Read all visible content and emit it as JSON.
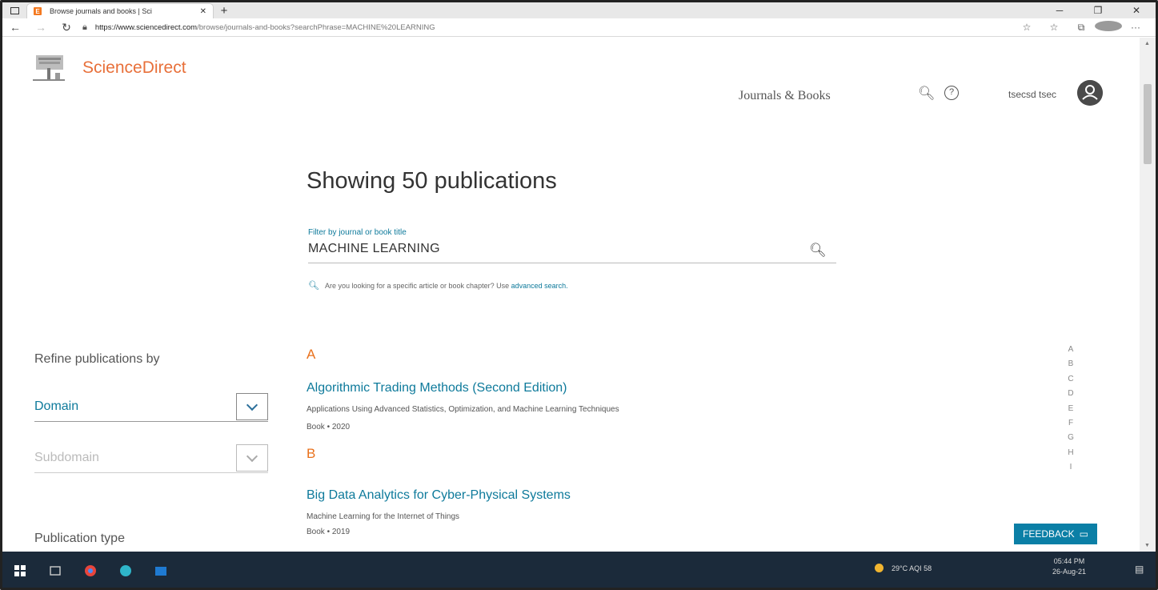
{
  "browser": {
    "tab_title": "Browse journals and books | Sci",
    "tab_favicon": "E",
    "tab_close": "✕",
    "new_tab": "+",
    "window_controls": [
      "─",
      "❐",
      "✕"
    ],
    "url_domain": "https://www.sciencedirect.com",
    "url_path": "/browse/journals-and-books?searchPhrase=MACHINE%20LEARNING"
  },
  "header": {
    "brand": "ScienceDirect",
    "journals_link": "Journals & Books",
    "user_name": "tsecsd tsec"
  },
  "main": {
    "heading": "Showing 50 publications",
    "filter_label": "Filter by journal or book title",
    "filter_value": "MACHINE LEARNING",
    "hint_text": "Are you looking for a specific article or book chapter? Use ",
    "hint_link": "advanced search."
  },
  "sidebar": {
    "refine_title": "Refine publications by",
    "domain_label": "Domain",
    "subdomain_label": "Subdomain",
    "pubtype_title": "Publication type"
  },
  "results": [
    {
      "letter": "A",
      "title": "Algorithmic Trading Methods (Second Edition)",
      "subtitle": "Applications Using Advanced Statistics, Optimization, and Machine Learning Techniques",
      "meta": "Book • 2020"
    },
    {
      "letter": "B",
      "title": "Big Data Analytics for Cyber-Physical Systems",
      "subtitle": "Machine Learning for the Internet of Things",
      "meta": "Book • 2019"
    }
  ],
  "alphabet": [
    "A",
    "B",
    "C",
    "D",
    "E",
    "F",
    "G",
    "H",
    "I"
  ],
  "feedback_label": "FEEDBACK",
  "taskbar": {
    "weather": "29°C  AQI 58",
    "time": "05:44 PM",
    "date": "26-Aug-21"
  },
  "colors": {
    "accent": "#0e7a9b",
    "brand_orange": "#e8703a",
    "letter_orange": "#e9711c",
    "taskbar": "#1b2a3a"
  }
}
